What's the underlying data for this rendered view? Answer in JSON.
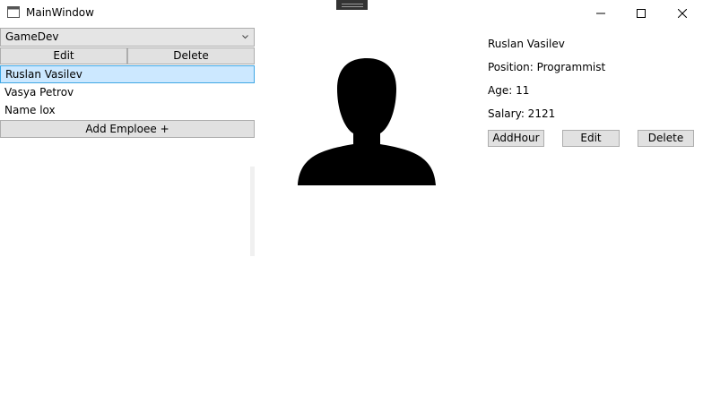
{
  "window": {
    "title": "MainWindow"
  },
  "caption_buttons": {
    "minimize": "—",
    "maximize": "☐",
    "close": "✕"
  },
  "department_select": {
    "selected": "GameDev"
  },
  "department_actions": {
    "edit_label": "Edit",
    "delete_label": "Delete"
  },
  "employees": [
    {
      "name": "Ruslan Vasilev",
      "selected": true
    },
    {
      "name": "Vasya Petrov",
      "selected": false
    },
    {
      "name": "Name lox",
      "selected": false
    }
  ],
  "add_employee_label": "Add Emploee +",
  "details": {
    "name": "Ruslan Vasilev",
    "position": "Position: Programmist",
    "age": "Age: 11",
    "salary": "Salary: 2121"
  },
  "detail_actions": {
    "add_hour_label": "AddHour",
    "edit_label": "Edit",
    "delete_label": "Delete"
  },
  "icons": {
    "avatar": "person-silhouette-icon",
    "app": "window-icon"
  }
}
